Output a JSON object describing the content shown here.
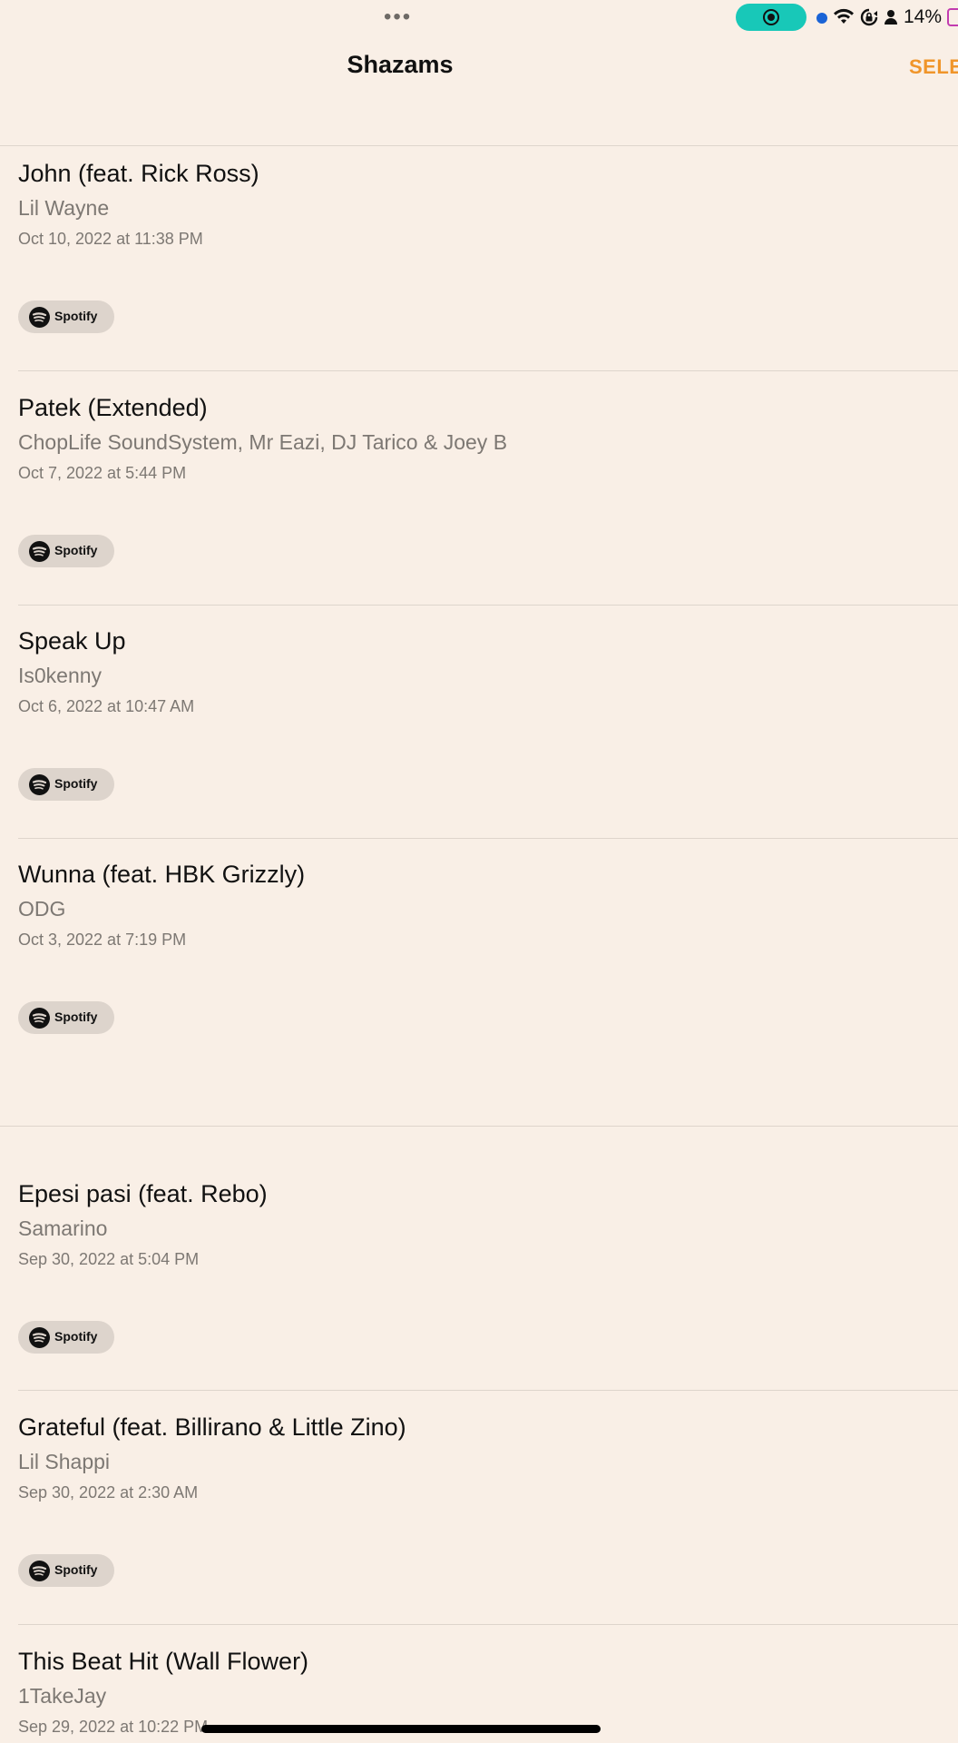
{
  "status_bar": {
    "battery_percent": "14%",
    "icons": [
      "more-dots-icon",
      "screen-record-icon",
      "blue-dot-icon",
      "wifi-icon",
      "rotation-lock-icon",
      "person-icon",
      "battery-icon"
    ],
    "record_color": "#18c8b8"
  },
  "header": {
    "title": "Shazams",
    "select_label": "SELE",
    "accent_color": "#f0952a"
  },
  "items": [
    {
      "title": "John (feat. Rick Ross)",
      "artist": "Lil Wayne",
      "date": "Oct 10, 2022 at 11:38 PM",
      "service": "Spotify"
    },
    {
      "title": "Patek (Extended)",
      "artist": "ChopLife SoundSystem, Mr Eazi, DJ Tarico & Joey B",
      "date": "Oct 7, 2022 at 5:44 PM",
      "service": "Spotify"
    },
    {
      "title": "Speak Up",
      "artist": "Is0kenny",
      "date": "Oct 6, 2022 at 10:47 AM",
      "service": "Spotify"
    },
    {
      "title": "Wunna (feat. HBK Grizzly)",
      "artist": "ODG",
      "date": "Oct 3, 2022 at 7:19 PM",
      "service": "Spotify"
    },
    {
      "title": "Epesi pasi (feat. Rebo)",
      "artist": "Samarino",
      "date": "Sep 30, 2022 at 5:04 PM",
      "service": "Spotify"
    },
    {
      "title": "Grateful (feat. Billirano & Little Zino)",
      "artist": "Lil Shappi",
      "date": "Sep 30, 2022 at 2:30 AM",
      "service": "Spotify"
    },
    {
      "title": "This Beat Hit (Wall Flower)",
      "artist": "1TakeJay",
      "date": "Sep 29, 2022 at 10:22 PM",
      "service": ""
    }
  ]
}
